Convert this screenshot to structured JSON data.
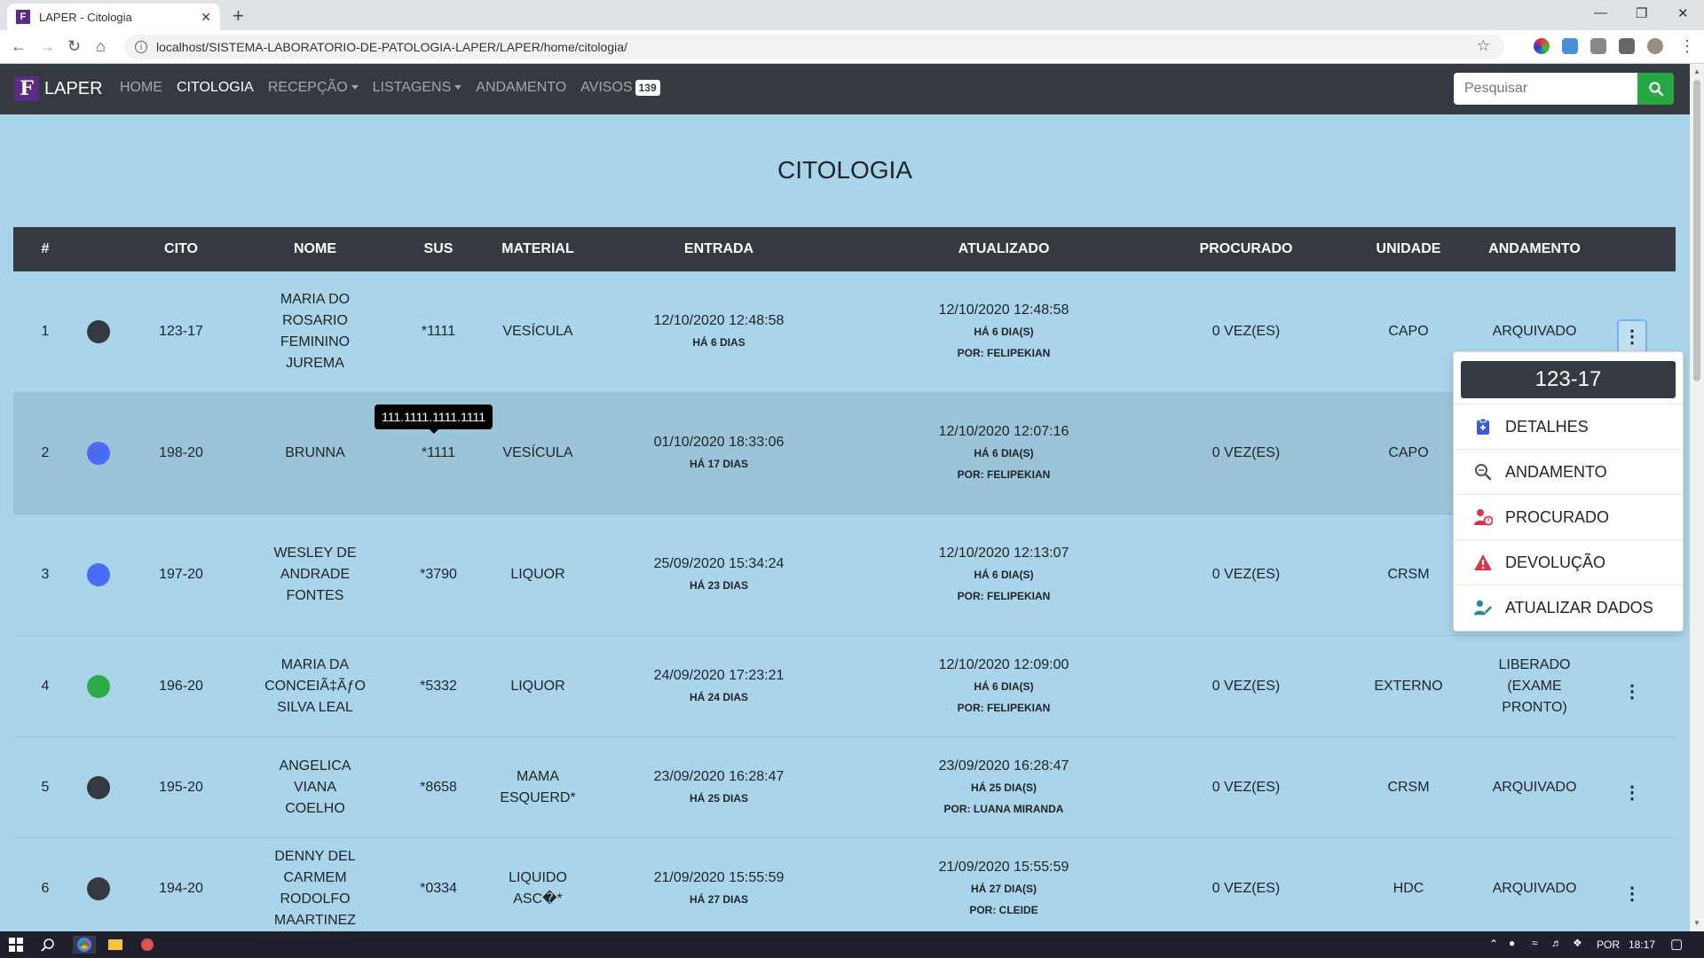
{
  "browser": {
    "tab_title": "LAPER - Citologia",
    "tab_close": "✕",
    "new_tab": "+",
    "url": "localhost/SISTEMA-LABORATORIO-DE-PATOLOGIA-LAPER/LAPER/home/citologia/"
  },
  "navbar": {
    "brand": "LAPER",
    "links": [
      "HOME",
      "CITOLOGIA",
      "RECEPÇÃO",
      "LISTAGENS",
      "ANDAMENTO",
      "AVISOS"
    ],
    "avisos_count": "139",
    "search_placeholder": "Pesquisar"
  },
  "page": {
    "title": "CITOLOGIA"
  },
  "table": {
    "headers": [
      "#",
      "CITO",
      "NOME",
      "SUS",
      "MATERIAL",
      "ENTRADA",
      "ATUALIZADO",
      "PROCURADO",
      "UNIDADE",
      "ANDAMENTO"
    ],
    "rows": [
      {
        "n": "1",
        "status_color": "#343a40",
        "cito": "123-17",
        "nome": "MARIA DO ROSARIO FEMININO JUREMA",
        "sus": "*1111",
        "material": "VESÍCULA",
        "entrada": "12/10/2020 12:48:58",
        "entrada_sub": "HÁ 6 DIAS",
        "atualizado": "12/10/2020 12:48:58",
        "atualizado_sub": "HÁ 6 DIA(S)",
        "atualizado_por": "POR: FELIPEKIAN",
        "procurado": "0 VEZ(ES)",
        "unidade": "CAPO",
        "andamento": "ARQUIVADO"
      },
      {
        "n": "2",
        "status_color": "#4a6cf7",
        "cito": "198-20",
        "nome": "BRUNNA",
        "sus": "*1111",
        "material": "VESÍCULA",
        "entrada": "01/10/2020 18:33:06",
        "entrada_sub": "HÁ 17 DIAS",
        "atualizado": "12/10/2020 12:07:16",
        "atualizado_sub": "HÁ 6 DIA(S)",
        "atualizado_por": "POR: FELIPEKIAN",
        "procurado": "0 VEZ(ES)",
        "unidade": "CAPO",
        "andamento": ""
      },
      {
        "n": "3",
        "status_color": "#4a6cf7",
        "cito": "197-20",
        "nome": "WESLEY DE ANDRADE FONTES",
        "sus": "*3790",
        "material": "LIQUOR",
        "entrada": "25/09/2020 15:34:24",
        "entrada_sub": "HÁ 23 DIAS",
        "atualizado": "12/10/2020 12:13:07",
        "atualizado_sub": "HÁ 6 DIA(S)",
        "atualizado_por": "POR: FELIPEKIAN",
        "procurado": "0 VEZ(ES)",
        "unidade": "CRSM",
        "andamento": ""
      },
      {
        "n": "4",
        "status_color": "#2eaa48",
        "cito": "196-20",
        "nome": "MARIA DA CONCEIÃ‡ÃƒO SILVA LEAL",
        "sus": "*5332",
        "material": "LIQUOR",
        "entrada": "24/09/2020 17:23:21",
        "entrada_sub": "HÁ 24 DIAS",
        "atualizado": "12/10/2020 12:09:00",
        "atualizado_sub": "HÁ 6 DIA(S)",
        "atualizado_por": "POR: FELIPEKIAN",
        "procurado": "0 VEZ(ES)",
        "unidade": "EXTERNO",
        "andamento": "LIBERADO (EXAME PRONTO)"
      },
      {
        "n": "5",
        "status_color": "#343a40",
        "cito": "195-20",
        "nome": "ANGELICA VIANA COELHO",
        "sus": "*8658",
        "material": "MAMA ESQUERD*",
        "entrada": "23/09/2020 16:28:47",
        "entrada_sub": "HÁ 25 DIAS",
        "atualizado": "23/09/2020 16:28:47",
        "atualizado_sub": "HÁ 25 DIA(S)",
        "atualizado_por": "POR: LUANA MIRANDA",
        "procurado": "0 VEZ(ES)",
        "unidade": "CRSM",
        "andamento": "ARQUIVADO"
      },
      {
        "n": "6",
        "status_color": "#343a40",
        "cito": "194-20",
        "nome": "DENNY DEL CARMEM RODOLFO MAARTINEZ",
        "sus": "*0334",
        "material": "LIQUIDO ASC�*",
        "entrada": "21/09/2020 15:55:59",
        "entrada_sub": "HÁ 27 DIAS",
        "atualizado": "21/09/2020 15:55:59",
        "atualizado_sub": "HÁ 27 DIA(S)",
        "atualizado_por": "POR: CLEIDE",
        "procurado": "0 VEZ(ES)",
        "unidade": "HDC",
        "andamento": "ARQUIVADO"
      }
    ]
  },
  "tooltip": {
    "text": "111.1111.1111.1111"
  },
  "menu": {
    "header": "123-17",
    "items": [
      {
        "label": "DETALHES",
        "icon": "clipboard-icon",
        "color": "#3b5bdb"
      },
      {
        "label": "ANDAMENTO",
        "icon": "magnifier-icon",
        "color": "#555555"
      },
      {
        "label": "PROCURADO",
        "icon": "user-clock-icon",
        "color": "#dc3545"
      },
      {
        "label": "DEVOLUÇÃO",
        "icon": "warning-icon",
        "color": "#dc3545"
      },
      {
        "label": "ATUALIZAR DADOS",
        "icon": "user-edit-icon",
        "color": "#2b8a9a"
      }
    ]
  },
  "taskbar": {
    "lang": "POR",
    "time": "18:17"
  },
  "colors": {
    "navbar": "#343a40",
    "page_bg": "#a9d4ea",
    "search_button": "#28a745"
  }
}
